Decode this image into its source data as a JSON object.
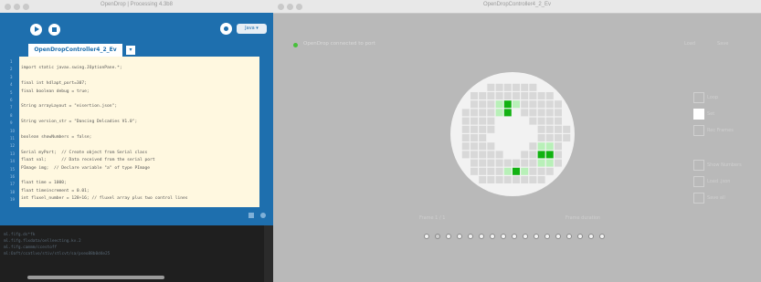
{
  "left_window": {
    "title": "OpenDrop | Processing 4.3b8",
    "mode_label": "Java ▾",
    "tab_label": "OpenDropController4_2_Ev",
    "tab_arrow": "▾",
    "code_lines": [
      {
        "n": "1",
        "t": ""
      },
      {
        "n": "2",
        "t": "import static javax.swing.JOptionPane.*;"
      },
      {
        "n": "3",
        "t": ""
      },
      {
        "n": "4",
        "t": "final int hdlapt_port=307;"
      },
      {
        "n": "5",
        "t": "final boolean debug = true;"
      },
      {
        "n": "6",
        "t": ""
      },
      {
        "n": "7",
        "t": "String arrayLayout = \"eisertion.json\";"
      },
      {
        "n": "8",
        "t": ""
      },
      {
        "n": "9",
        "t": "String version_str = \"Dancing Delcadies V1.0\";"
      },
      {
        "n": "10",
        "t": ""
      },
      {
        "n": "11",
        "t": "boolean showNumbers = false;"
      },
      {
        "n": "12",
        "t": ""
      },
      {
        "n": "13",
        "t": "Serial myPort;  // Create object from Serial class"
      },
      {
        "n": "14",
        "t": "float val;      // Data received from the serial port"
      },
      {
        "n": "15",
        "t": "PImage img;  // Declare variable \"a\" of type PImage"
      },
      {
        "n": "16",
        "t": ""
      },
      {
        "n": "17",
        "t": "float time = 1000;"
      },
      {
        "n": "18",
        "t": "float timeincrement = 0.01;"
      },
      {
        "n": "19",
        "t": "int fluxel_number = 128+16; // fluxel array plus two control lines"
      }
    ],
    "console_lines": [
      "ml.fifg.ds*fk",
      "ml.fifg.flxdata/oelleecting.kv.2",
      "ml.fifg.cammm/ccestoff",
      "ml:Oaft/ccatlvo/stiv/stlcvt/sa/pseo88b0d4e25"
    ]
  },
  "right_window": {
    "title": "OpenDropController4_2_Ev",
    "status_text": "OpenDrop connected to port",
    "top_right_labels": [
      "Load",
      "Save"
    ],
    "checkboxes_top": [
      {
        "label": "Loop",
        "checked": false
      },
      {
        "label": "Set",
        "checked": true
      },
      {
        "label": "Rec Frames",
        "checked": false
      }
    ],
    "checkboxes_bottom": [
      {
        "label": "Show Numbers",
        "checked": false
      },
      {
        "label": "Load .json",
        "checked": false
      },
      {
        "label": "Save all",
        "checked": false
      }
    ],
    "bottom_left_label": "Frame 1 / 1",
    "bottom_right_label": "Frame duration",
    "frame_dots": 17,
    "selected_dot": 1,
    "grid_colors": {
      "off": "#d8d8d8",
      "light": "#b8f0b8",
      "active": "#11b211",
      "hole": "#ffffff",
      "disk": "#f2f2f2"
    }
  }
}
